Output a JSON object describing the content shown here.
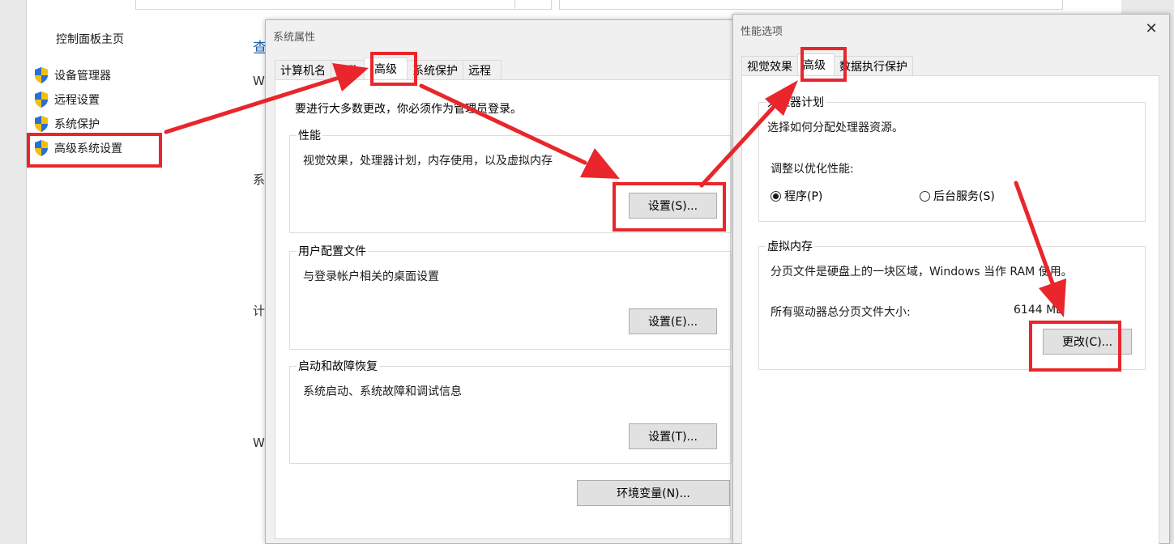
{
  "control_panel": {
    "title": "控制面板主页",
    "links": [
      "设备管理器",
      "远程设置",
      "系统保护",
      "高级系统设置"
    ],
    "fragments": [
      "查",
      "W",
      "系",
      "计",
      "W"
    ]
  },
  "system_properties": {
    "title": "系统属性",
    "tabs": [
      "计算机名",
      "硬件",
      "高级",
      "系统保护",
      "远程"
    ],
    "active_tab": 2,
    "admin_note": "要进行大多数更改，你必须作为管理员登录。",
    "performance": {
      "label": "性能",
      "desc": "视觉效果，处理器计划，内存使用，以及虚拟内存",
      "button": "设置(S)..."
    },
    "user_profiles": {
      "label": "用户配置文件",
      "desc": "与登录帐户相关的桌面设置",
      "button": "设置(E)..."
    },
    "startup_recovery": {
      "label": "启动和故障恢复",
      "desc": "系统启动、系统故障和调试信息",
      "button": "设置(T)..."
    },
    "env_button": "环境变量(N)..."
  },
  "performance_options": {
    "title": "性能选项",
    "close": "✕",
    "tabs": [
      "视觉效果",
      "高级",
      "数据执行保护"
    ],
    "active_tab": 1,
    "processor": {
      "label": "处理器计划",
      "desc": "选择如何分配处理器资源。",
      "adjust": "调整以优化性能:",
      "option_programs": "程序(P)",
      "option_services": "后台服务(S)",
      "selected": "程序(P)"
    },
    "virtual_memory": {
      "label": "虚拟内存",
      "desc": "分页文件是硬盘上的一块区域，Windows 当作 RAM 使用。",
      "total_label": "所有驱动器总分页文件大小:",
      "total_value": "6144 MB",
      "button": "更改(C)..."
    }
  },
  "colors": {
    "highlight": "#e8262b",
    "shield_blue": "#2a6fd6",
    "shield_yellow": "#f2c200"
  }
}
